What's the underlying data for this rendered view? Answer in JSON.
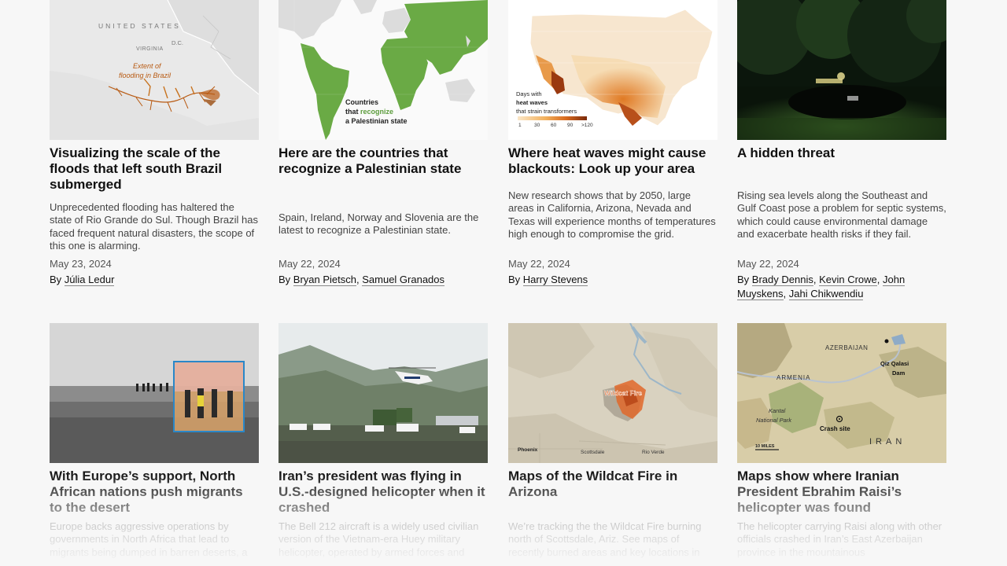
{
  "cards": [
    {
      "headline": "Visualizing the scale of the floods that left south Brazil submerged",
      "blurb": "Unprecedented flooding has haltered the state of Rio Grande do Sul. Though Brazil has faced frequent natural disasters, the scope of this one is alarming.",
      "date": "May 23, 2024",
      "by": "By",
      "authors": [
        "Júlia Ledur"
      ],
      "thumb_labels": {
        "country": "UNITED STATES",
        "region": "VIRGINIA",
        "city": "D.C.",
        "overlay_line1": "Extent of",
        "overlay_line2": "flooding in Brazil"
      },
      "accent": "#b85a12"
    },
    {
      "headline": "Here are the countries that recognize a Palestinian state",
      "blurb": "Spain, Ireland, Norway and Slovenia are the latest to recognize a Palestinian state.",
      "date": "May 22, 2024",
      "by": "By",
      "authors": [
        "Bryan Pietsch",
        "Samuel Granados"
      ],
      "thumb_labels": {
        "legend_line1": "Countries",
        "legend_line2a": "that ",
        "legend_line2b": "recognize",
        "legend_line3": "a Palestinian state"
      },
      "accent": "#6aaa45"
    },
    {
      "headline": "Where heat waves might cause blackouts: Look up your area",
      "blurb": "New research shows that by 2050, large areas in California, Arizona, Nevada and Texas will experience months of temperatures high enough to compromise the grid.",
      "date": "May 22, 2024",
      "by": "By",
      "authors": [
        "Harry Stevens"
      ],
      "thumb_labels": {
        "legend_line1": "Days with",
        "legend_line2": "heat waves",
        "legend_line3": "that strain transformers",
        "ticks": [
          "1",
          "30",
          "60",
          "90",
          ">120"
        ]
      },
      "accent": "#d9782b"
    },
    {
      "headline": "A hidden threat",
      "blurb": "Rising sea levels along the Southeast and Gulf Coast pose a problem for septic systems, which could cause environmental damage and exacerbate health risks if they fail.",
      "date": "May 22, 2024",
      "by": "By",
      "authors": [
        "Brady Dennis",
        "Kevin Crowe",
        "John Muyskens",
        "Jahi Chikwendiu"
      ]
    },
    {
      "headline": "With Europe’s support, North African nations push migrants to the desert",
      "blurb": "Europe backs aggressive operations by governments in North Africa that lead to migrants being dumped in barren deserts, a",
      "date": "",
      "by": "",
      "authors": []
    },
    {
      "headline": "Iran’s president was flying in U.S.-designed helicopter when it crashed",
      "blurb": "The Bell 212 aircraft is a widely used civilian version of the Vietnam-era Huey military helicopter, operated by armed forces and",
      "date": "",
      "by": "",
      "authors": []
    },
    {
      "headline": "Maps of the Wildcat Fire in Arizona",
      "blurb": "We’re tracking the the Wildcat Fire burning north of Scottsdale, Ariz. See maps of recently burned areas and key locations in",
      "date": "",
      "by": "",
      "authors": [],
      "thumb_labels": {
        "fire": "Wildcat Fire",
        "city1": "Phoenix",
        "city2": "Scottsdale",
        "city3": "Rio Verde"
      },
      "accent": "#e0682a"
    },
    {
      "headline": "Maps show where Iranian President Ebrahim Raisi’s helicopter was found",
      "blurb": "The helicopter carrying Raisi along with other officials crashed in Iran’s East Azerbaijan province in the mountainous",
      "date": "",
      "by": "",
      "authors": [],
      "thumb_labels": {
        "country1": "AZERBAIJAN",
        "country2": "ARMENIA",
        "country3": "IRAN",
        "park_line1": "Kantal",
        "park_line2": "National Park",
        "dam_line1": "Qiz Qalasi",
        "dam_line2": "Dam",
        "crash": "Crash site",
        "scale": "10 MILES"
      }
    }
  ]
}
